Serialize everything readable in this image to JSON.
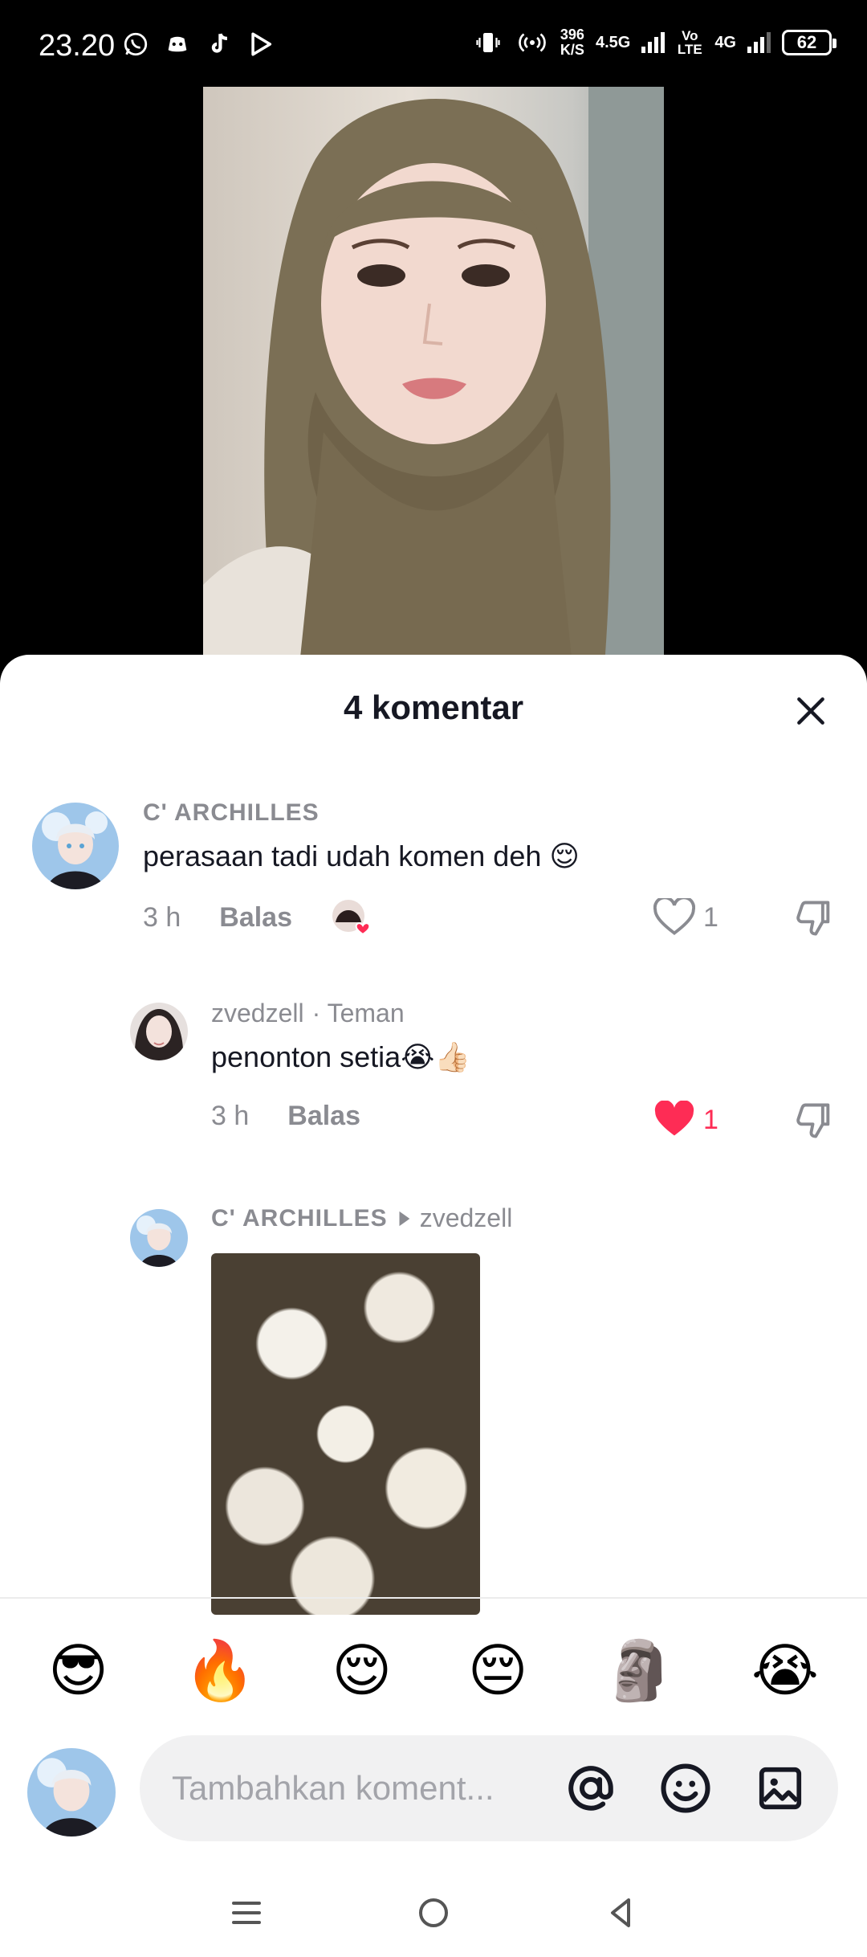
{
  "status_bar": {
    "time": "23.20",
    "speed_value": "396",
    "speed_unit": "K/S",
    "network_1": "4.5G",
    "volte": "Vo LTE",
    "network_2": "4G",
    "battery": "62"
  },
  "sheet": {
    "title": "4 komentar"
  },
  "comments": [
    {
      "username": "C' ARCHILLES",
      "text": "perasaan tadi udah komen deh 😌",
      "time": "3 h",
      "reply_label": "Balas",
      "likes": "1",
      "liked": false
    },
    {
      "username": "zvedzell",
      "tag": "· Teman",
      "text": "penonton setia😭👍🏻",
      "time": "3 h",
      "reply_label": "Balas",
      "likes": "1",
      "liked": true
    },
    {
      "username": "C' ARCHILLES",
      "reply_to": "zvedzell"
    }
  ],
  "emoji_bar": [
    "😎",
    "🔥",
    "😌",
    "😔",
    "🗿",
    "😭"
  ],
  "input": {
    "placeholder": "Tambahkan koment..."
  },
  "colors": {
    "like_red": "#fe2c55",
    "text_primary": "#161823",
    "text_secondary": "#8a8b91"
  }
}
